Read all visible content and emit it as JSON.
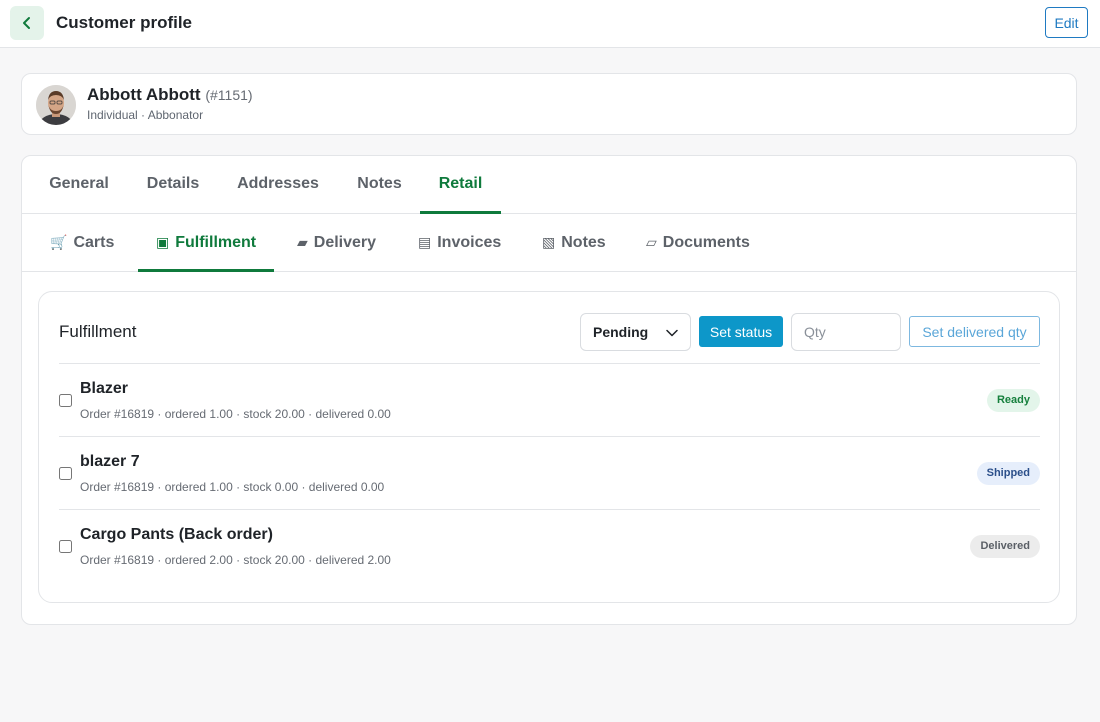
{
  "header": {
    "title": "Customer profile",
    "edit_label": "Edit"
  },
  "customer": {
    "name": "Abbott Abbott",
    "id": "(#1151)",
    "subtitle": "Individual · Abbonator"
  },
  "tabs": [
    {
      "label": "General"
    },
    {
      "label": "Details"
    },
    {
      "label": "Addresses"
    },
    {
      "label": "Notes"
    },
    {
      "label": "Retail"
    }
  ],
  "active_tab": "Retail",
  "subtabs": [
    {
      "label": "Carts",
      "icon": "cart-icon"
    },
    {
      "label": "Fulfillment",
      "icon": "fulfillment-icon"
    },
    {
      "label": "Delivery",
      "icon": "delivery-icon"
    },
    {
      "label": "Invoices",
      "icon": "invoice-icon"
    },
    {
      "label": "Notes",
      "icon": "notes-icon"
    },
    {
      "label": "Documents",
      "icon": "documents-icon"
    }
  ],
  "active_subtab": "Fulfillment",
  "fulfillment": {
    "title": "Fulfillment",
    "status_value": "Pending",
    "set_status_label": "Set status",
    "qty_placeholder": "Qty",
    "set_qty_label": "Set delivered qty",
    "items": [
      {
        "name": "Blazer",
        "meta": "Order #16819 · ordered 1.00 · stock 20.00 · delivered 0.00",
        "status": "Ready"
      },
      {
        "name": "blazer 7",
        "meta": "Order #16819 · ordered 1.00 · stock 0.00 · delivered 0.00",
        "status": "Shipped"
      },
      {
        "name": "Cargo Pants (Back order)",
        "meta": "Order #16819 · ordered 2.00 · stock 20.00 · delivered 2.00",
        "status": "Delivered"
      }
    ]
  },
  "colors": {
    "accent_green": "#0f7a3c",
    "primary_blue": "#0d97c9",
    "link_blue": "#1f7ac2",
    "badge_ready_bg": "#e3f5ea",
    "badge_ready_fg": "#16803d",
    "badge_shipped_bg": "#e6eefb",
    "badge_shipped_fg": "#2b4f8a",
    "badge_delivered_bg": "#ececec",
    "badge_delivered_fg": "#5a5f66"
  }
}
